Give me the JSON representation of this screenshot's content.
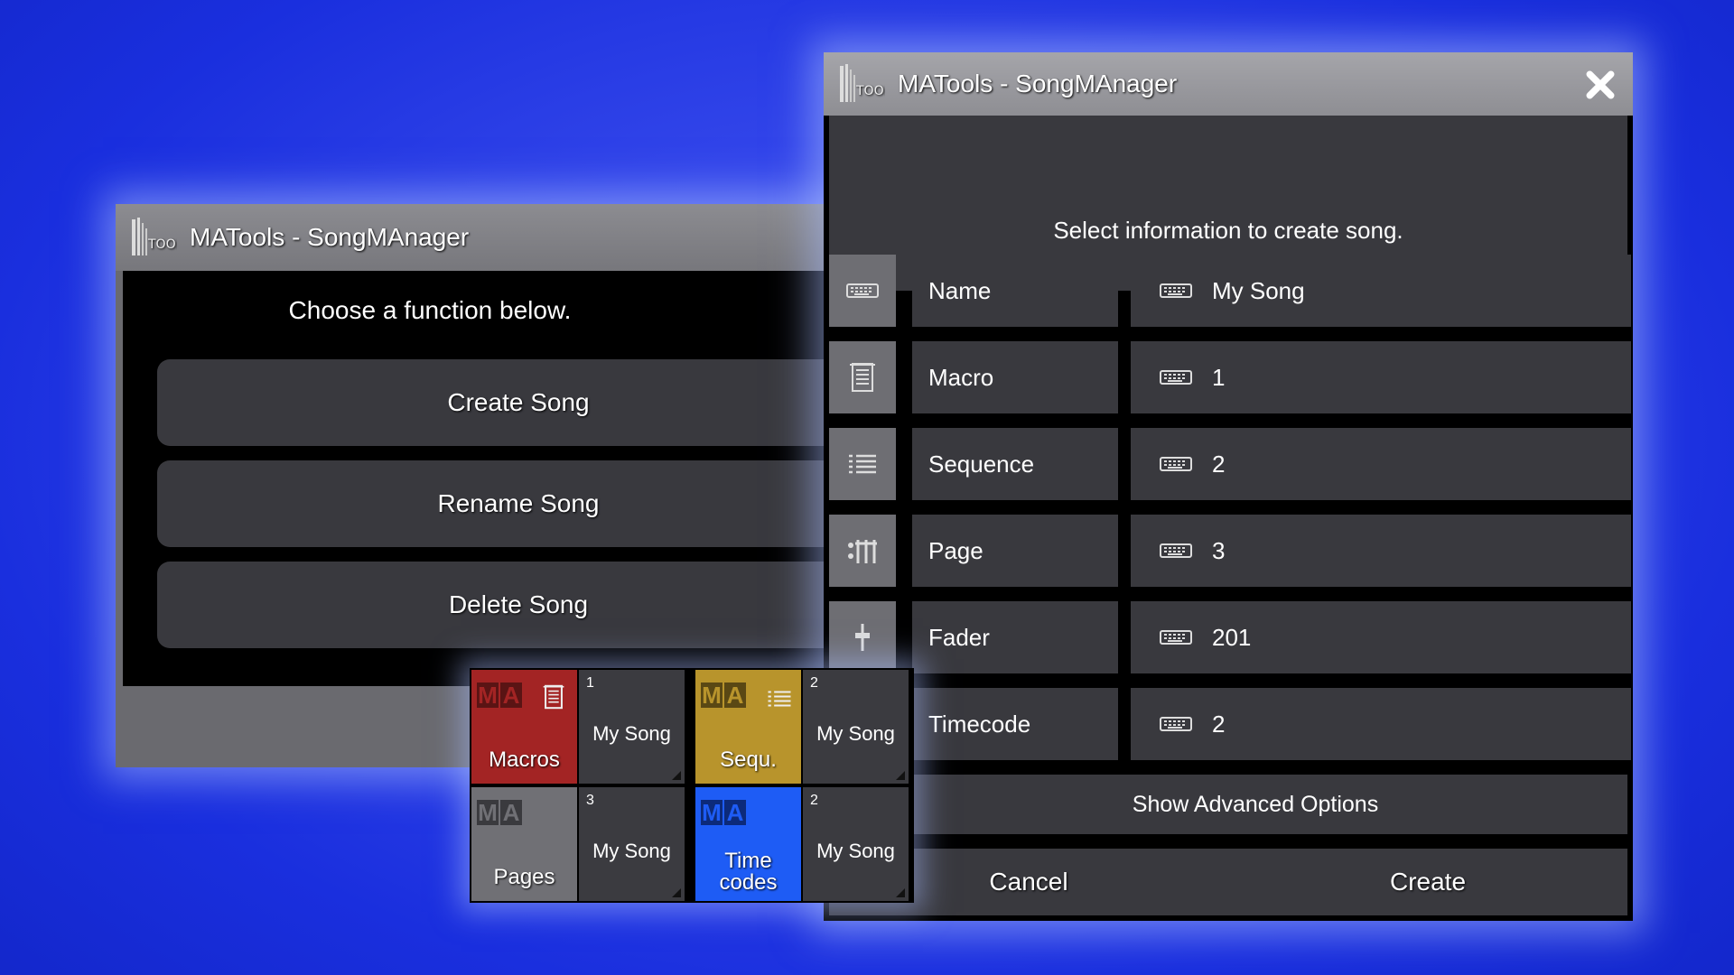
{
  "left_window": {
    "title": "MATools - SongMAnager",
    "prompt": "Choose a function below.",
    "buttons": [
      "Create Song",
      "Rename Song",
      "Delete Song"
    ]
  },
  "right_window": {
    "title": "MATools - SongMAnager",
    "prompt": "Select information to create song.",
    "rows": [
      {
        "label": "Name",
        "value": "My Song",
        "icon": "keyboard-icon"
      },
      {
        "label": "Macro",
        "value": "1",
        "icon": "macro-icon"
      },
      {
        "label": "Sequence",
        "value": "2",
        "icon": "list-icon"
      },
      {
        "label": "Page",
        "value": "3",
        "icon": "page-icon"
      },
      {
        "label": "Fader",
        "value": "201",
        "icon": "fader-icon"
      },
      {
        "label": "Timecode",
        "value": "2",
        "icon": "timecode-icon"
      }
    ],
    "advanced_label": "Show Advanced Options",
    "cancel_label": "Cancel",
    "create_label": "Create"
  },
  "pool_grid": {
    "ma_letters": "MA",
    "pools": [
      {
        "label": "Macros",
        "number": "1",
        "item": "My Song",
        "color": "#a32424"
      },
      {
        "label": "Sequ.",
        "number": "2",
        "item": "My Song",
        "color": "#b8942c"
      },
      {
        "label": "Pages",
        "number": "3",
        "item": "My Song",
        "color": "#707075"
      },
      {
        "label": "Time codes",
        "label_line1": "Time",
        "label_line2": "codes",
        "number": "2",
        "item": "My Song",
        "color": "#1e5cf5"
      }
    ]
  }
}
